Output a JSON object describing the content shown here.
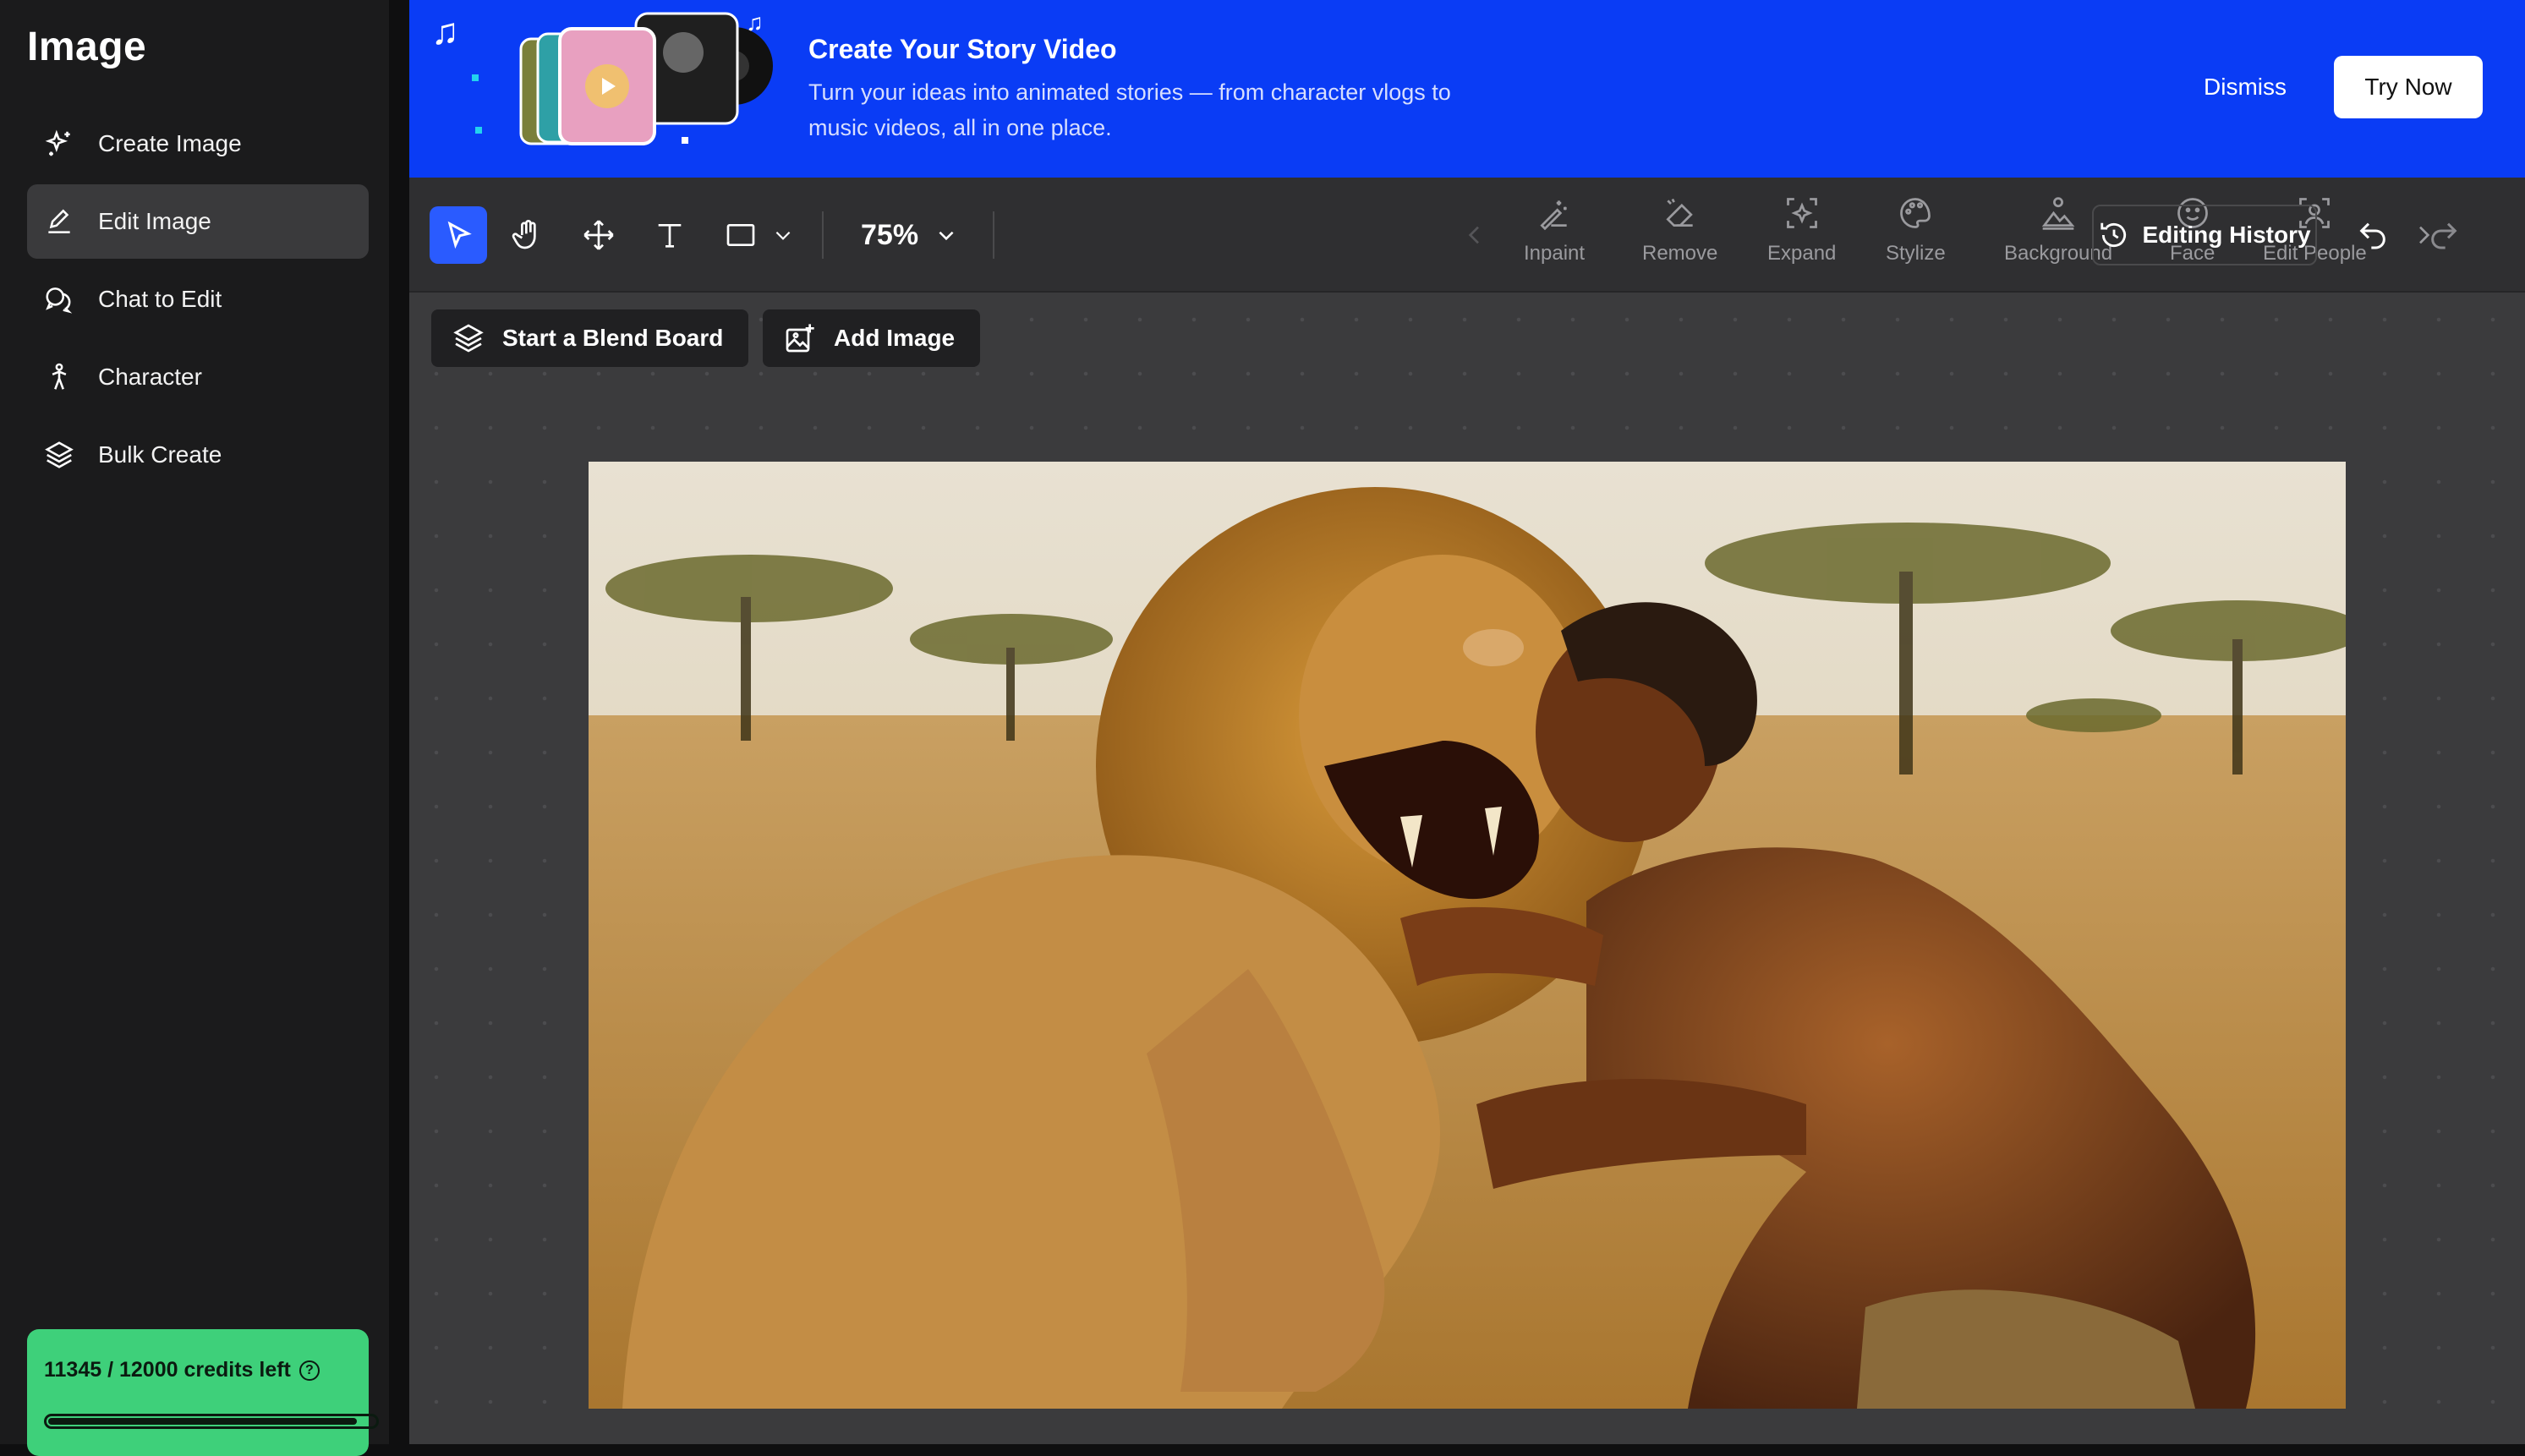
{
  "sidebar": {
    "title": "Image",
    "items": [
      {
        "label": "Create Image",
        "icon": "sparkle-icon"
      },
      {
        "label": "Edit Image",
        "icon": "pencil-icon",
        "active": true
      },
      {
        "label": "Chat to Edit",
        "icon": "chat-bubbles-icon"
      },
      {
        "label": "Character",
        "icon": "person-running-icon"
      },
      {
        "label": "Bulk Create",
        "icon": "layers-icon"
      }
    ],
    "credits": {
      "text": "11345 / 12000 credits left",
      "fraction": 0.945,
      "help_icon": "question-circle-icon"
    }
  },
  "banner": {
    "title": "Create Your Story Video",
    "subtitle": "Turn your ideas into animated stories — from character vlogs to music videos, all in one place.",
    "dismiss": "Dismiss",
    "try_now": "Try Now"
  },
  "toolbar": {
    "zoom": "75%",
    "tools": [
      {
        "label": "Inpaint",
        "icon": "magic-brush-icon"
      },
      {
        "label": "Remove",
        "icon": "eraser-icon"
      },
      {
        "label": "Expand",
        "icon": "expand-sparkle-icon"
      },
      {
        "label": "Stylize",
        "icon": "palette-icon"
      },
      {
        "label": "Background",
        "icon": "landscape-icon"
      },
      {
        "label": "Face",
        "icon": "smiley-icon"
      },
      {
        "label": "Edit People",
        "icon": "person-frame-icon"
      }
    ],
    "history": "Editing History"
  },
  "canvas": {
    "blend_board": "Start a Blend Board",
    "add_image": "Add Image"
  },
  "colors": {
    "accent": "#2a5bff",
    "banner": "#0a3cf5",
    "credits": "#3ed07a",
    "sidebar": "#1b1b1c",
    "canvas": "#3b3b3d"
  }
}
